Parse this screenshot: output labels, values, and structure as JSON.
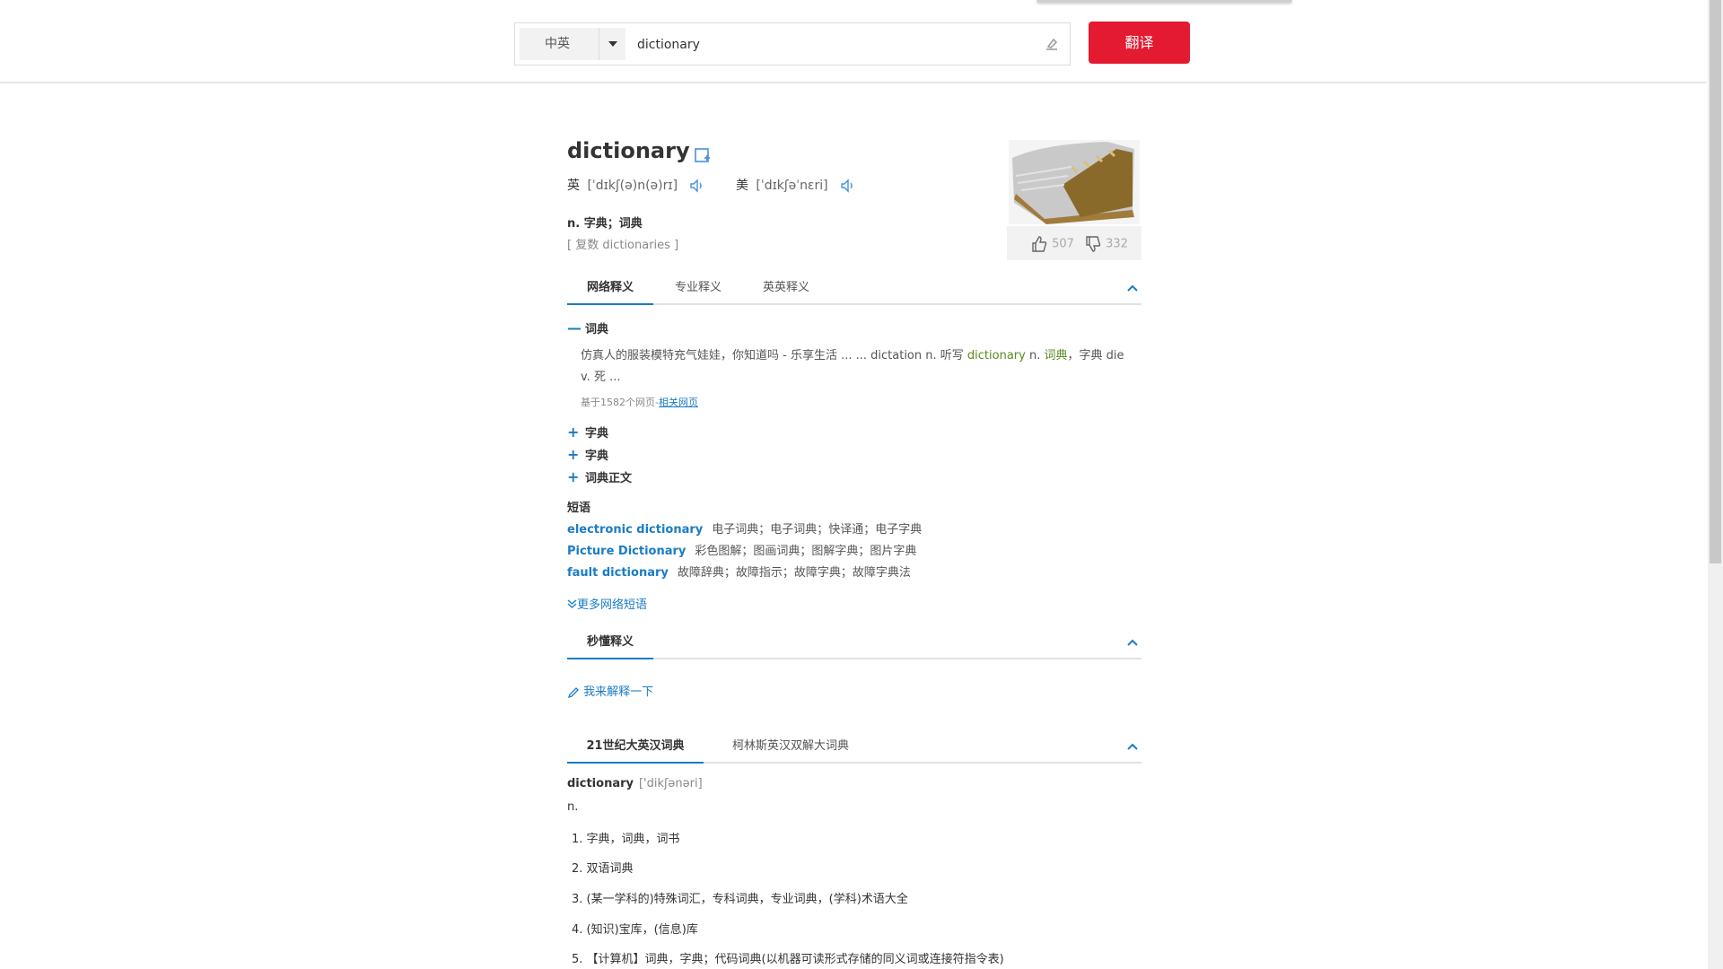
{
  "search": {
    "lang": "中英",
    "query": "dictionary",
    "translate_label": "翻译"
  },
  "word": {
    "headword": "dictionary",
    "uk_tag": "英",
    "uk_phonetic": "[ˈdɪkʃ(ə)n(ə)rɪ]",
    "us_tag": "美",
    "us_phonetic": "[ˈdɪkʃəˈnɛri]",
    "definition": "n. 字典；词典",
    "plural": "[ 复数 dictionaries ]",
    "likes": "507",
    "dislikes": "332"
  },
  "tabs1": [
    "网络释义",
    "专业释义",
    "英英释义"
  ],
  "web": {
    "title": "词典",
    "text_before": "仿真人的服装模特充气娃娃，你知道吗 - 乐享生活 ... ... dictation n. 听写 ",
    "hl1": "dictionary",
    "text_mid": " n. ",
    "hl2": "词典",
    "text_after": "，字典 die v. 死 ...",
    "source_prefix": "基于1582个网页-",
    "source_link": "相关网页",
    "more": [
      "字典",
      "字典",
      "词典正文"
    ]
  },
  "phrases": {
    "title": "短语",
    "items": [
      {
        "en": "electronic dictionary",
        "zh": "电子词典；电子词典；快译通；电子字典"
      },
      {
        "en": "Picture Dictionary",
        "zh": "彩色图解；图画词典；图解字典；图片字典"
      },
      {
        "en": "fault dictionary",
        "zh": "故障辞典；故障指示；故障字典；故障字典法"
      }
    ],
    "more_label": "更多网络短语"
  },
  "tabs2": [
    "秒懂释义"
  ],
  "explain_label": "我来解释一下",
  "tabs3": [
    "21世纪大英汉词典",
    "柯林斯英汉双解大词典"
  ],
  "dict21": {
    "word": "dictionary",
    "phonetic": "['dikʃənəri]",
    "pos": "n.",
    "items": [
      "1. 字典，词典，词书",
      "2. 双语词典",
      "3. (某一学科的)特殊词汇，专科词典，专业词典，(学科)术语大全",
      "4. (知识)宝库，(信息)库",
      "5. 【计算机】词典，字典；代码词典(以机器可读形式存储的同义词或连接符指令表)"
    ]
  },
  "colors": {
    "accent": "#e31a30",
    "link": "#1a7cc5",
    "highlight": "#5a8a1e"
  }
}
